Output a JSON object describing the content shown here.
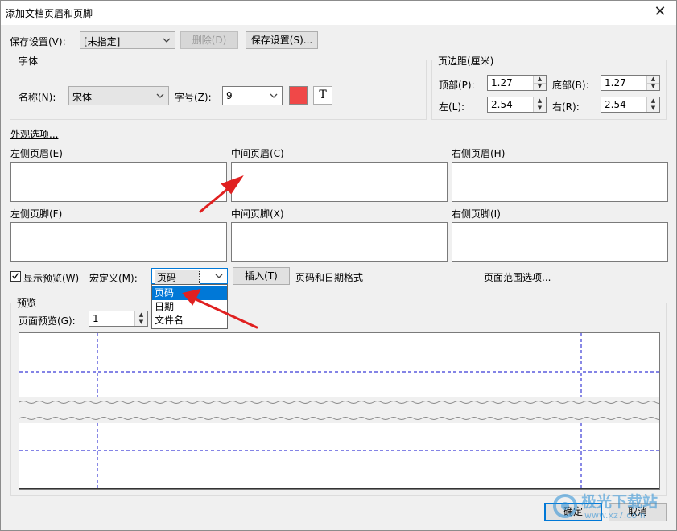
{
  "window": {
    "title": "添加文档页眉和页脚",
    "close_glyph": "✕"
  },
  "save_settings": {
    "label": "保存设置(V):",
    "selected": "[未指定]",
    "delete_label": "删除(D)",
    "save_label": "保存设置(S)..."
  },
  "font": {
    "group_label": "字体",
    "name_label": "名称(N):",
    "name_value": "宋体",
    "size_label": "字号(Z):",
    "size_value": "9",
    "color": "#f04848",
    "text_tool_glyph": "T"
  },
  "margins": {
    "group_label": "页边距(厘米)",
    "top_label": "顶部(P):",
    "top_value": "1.27",
    "bottom_label": "底部(B):",
    "bottom_value": "1.27",
    "left_label": "左(L):",
    "left_value": "2.54",
    "right_label": "右(R):",
    "right_value": "2.54"
  },
  "appearance_link": "外观选项...",
  "headers": {
    "left_label": "左侧页眉(E)",
    "center_label": "中间页眉(C)",
    "right_label": "右侧页眉(H)"
  },
  "footers": {
    "left_label": "左侧页脚(F)",
    "center_label": "中间页脚(X)",
    "right_label": "右侧页脚(I)"
  },
  "options": {
    "show_preview_label": "显示预览(W)",
    "show_preview_checked": true,
    "macro_label": "宏定义(M):",
    "macro_selected": "页码",
    "insert_label": "插入(T)",
    "page_date_format_link": "页码和日期格式",
    "page_range_link": "页面范围选项..."
  },
  "macro_dropdown": {
    "options": [
      "页码",
      "日期",
      "文件名"
    ],
    "highlighted_index": 0
  },
  "preview": {
    "group_label": "预览",
    "page_preview_label": "页面预览(G):",
    "page_preview_value": "1",
    "guide_color": "#3b3bd6"
  },
  "buttons": {
    "ok_label": "确定",
    "cancel_label": "取消"
  },
  "annotations": {
    "arrow_color": "#e02020"
  },
  "watermark": {
    "text": "极光下载站",
    "url": "www.xz7.com"
  }
}
